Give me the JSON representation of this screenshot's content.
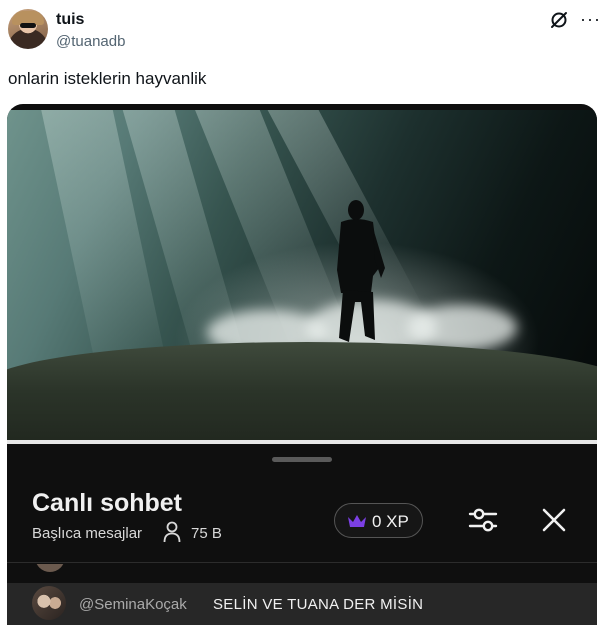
{
  "tweet": {
    "display_name": "tuis",
    "handle": "@tuanadb",
    "text": "onlarin isteklerin hayvanlik",
    "icons": {
      "avatar": "user-avatar",
      "grok": "grok-icon",
      "more": "more-icon"
    }
  },
  "media": {
    "description_icon": "video-frame"
  },
  "live_chat": {
    "title": "Canlı sohbet",
    "mode": "Başlıca mesajlar",
    "viewer_count": "75 B",
    "xp_label": "0 XP",
    "accent_color": "#7b3fe4",
    "icons": [
      "viewers-icon",
      "crown-icon",
      "filter-icon",
      "close-icon"
    ],
    "message": {
      "author": "@SeminaKoçak",
      "text": "SELİN VE TUANA DER MİSİN"
    }
  }
}
